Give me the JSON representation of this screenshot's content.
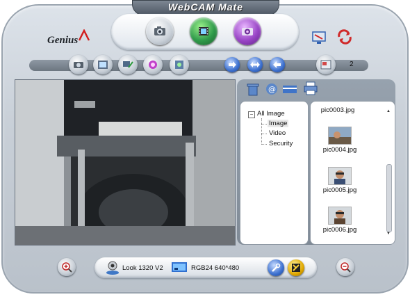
{
  "window": {
    "title": "WebCAM Mate"
  },
  "brand": {
    "logo_text": "Genius"
  },
  "modes": [
    {
      "name": "capture",
      "icon": "camera-icon"
    },
    {
      "name": "video",
      "icon": "film-icon"
    },
    {
      "name": "security",
      "icon": "security-icon"
    }
  ],
  "toolbar": {
    "icons": [
      "snapshot-icon",
      "frame-icon",
      "photo-edit-icon",
      "effects-icon",
      "export-icon"
    ],
    "nav_icons": [
      "arrow-right-icon",
      "arrow-both-icon",
      "arrow-left-icon"
    ],
    "page_count": "2"
  },
  "panel": {
    "icons": [
      "trash-icon",
      "email-icon",
      "card-icon",
      "printer-icon"
    ]
  },
  "tree": {
    "root": "All Image",
    "items": [
      "Image",
      "Video",
      "Security"
    ],
    "selected": "Image"
  },
  "thumbnails": {
    "partial_top": "pic0003.jpg",
    "items": [
      {
        "label": "pic0004.jpg"
      },
      {
        "label": "pic0005.jpg"
      },
      {
        "label": "pic0006.jpg"
      }
    ]
  },
  "status": {
    "device": "Look 1320 V2",
    "format": "RGB24 640*480"
  },
  "colors": {
    "panel_bg": "#8d98a4",
    "accent_blue": "#3c70cf",
    "skin": "#c9d0d8"
  }
}
